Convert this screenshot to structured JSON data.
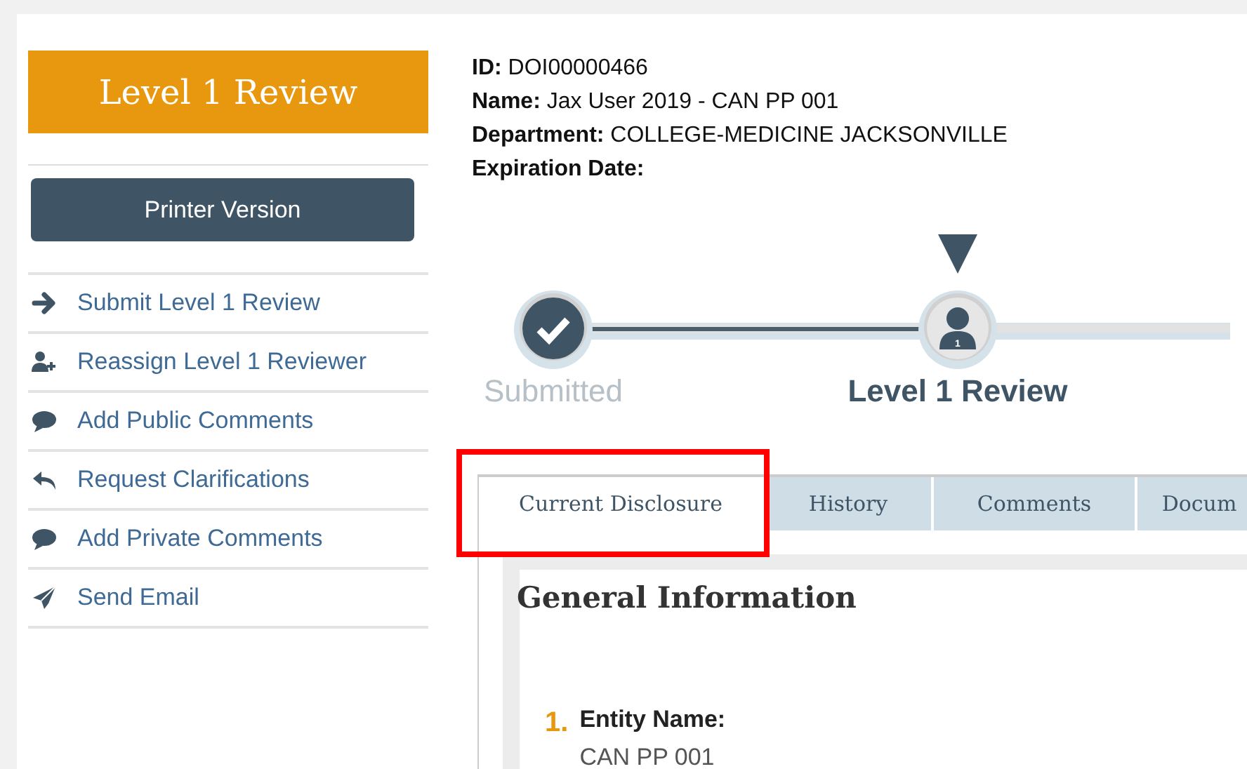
{
  "sidebar": {
    "title": "Level 1 Review",
    "printer_button": "Printer Version",
    "actions": [
      {
        "label": "Submit Level 1 Review"
      },
      {
        "label": "Reassign Level 1 Reviewer"
      },
      {
        "label": "Add Public Comments"
      },
      {
        "label": "Request Clarifications"
      },
      {
        "label": "Add Private Comments"
      },
      {
        "label": "Send Email"
      }
    ]
  },
  "details": [
    {
      "label": "ID:",
      "value": "DOI00000466"
    },
    {
      "label": "Name:",
      "value": "Jax User 2019 - CAN PP 001"
    },
    {
      "label": "Department:",
      "value": "COLLEGE-MEDICINE JACKSONVILLE"
    },
    {
      "label": "Expiration Date:"
    }
  ],
  "workflow": [
    {
      "label": "Submitted",
      "completed": true,
      "current": false
    },
    {
      "label": "Level 1 Review",
      "completed": false,
      "current": true,
      "badge": "1"
    }
  ],
  "tabs": [
    {
      "label": "Current Disclosure",
      "selected": true,
      "highlighted": true
    },
    {
      "label": "History",
      "selected": false,
      "highlighted": false
    },
    {
      "label": "Comments",
      "selected": false,
      "highlighted": false
    },
    {
      "label": "Docum",
      "selected": false,
      "highlighted": false
    }
  ],
  "section": {
    "title": "General Information",
    "questions": [
      {
        "number": "1.",
        "label": "Entity Name:",
        "answer": "CAN PP 001"
      }
    ]
  }
}
